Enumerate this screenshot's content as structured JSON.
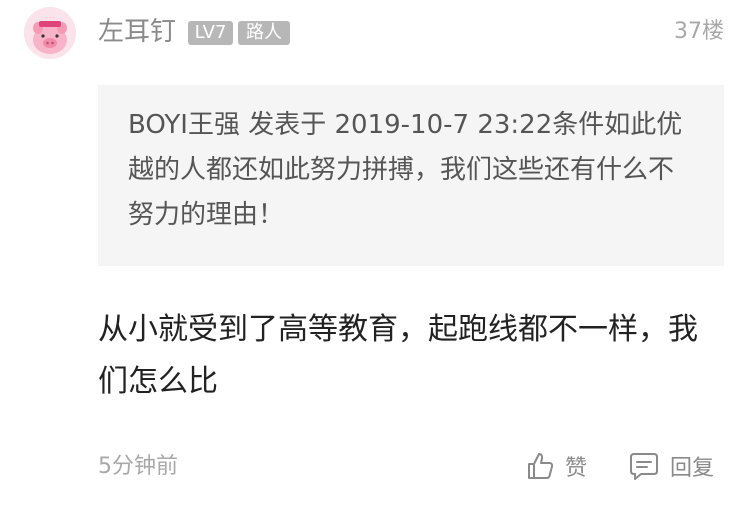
{
  "comment": {
    "user": {
      "name": "左耳钉",
      "level": "LV7",
      "rank": "路人",
      "avatar_icon": "pig-cartoon-avatar"
    },
    "floor": "37楼",
    "quote": {
      "text": "BOYI王强 发表于 2019-10-7 23:22条件如此优越的人都还如此努力拼搏，我们这些还有什么不努力的理由！"
    },
    "body": "从小就受到了高等教育，起跑线都不一样，我们怎么比",
    "time": "5分钟前",
    "actions": {
      "like_label": "赞",
      "reply_label": "回复"
    }
  },
  "colors": {
    "meta_gray": "#a8a8a8",
    "badge_gray": "#b7b7b7",
    "quote_bg": "#f5f5f5",
    "avatar_bg": "#fbe3ec"
  }
}
